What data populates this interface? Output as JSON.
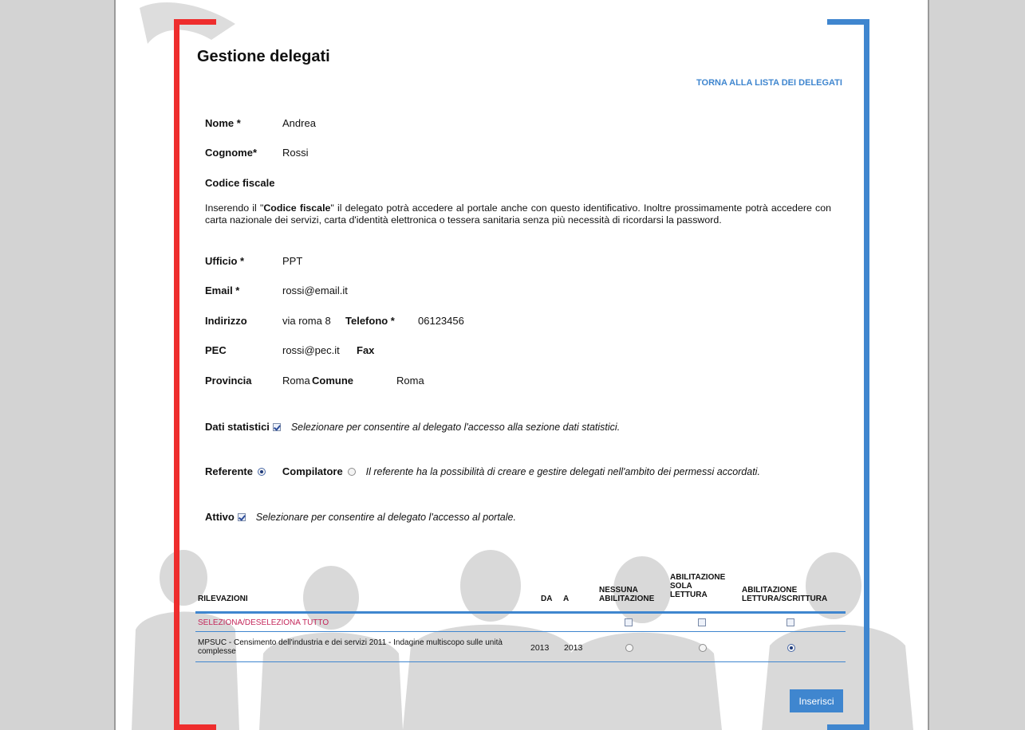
{
  "page": {
    "title": "Gestione delegati",
    "back_link": "TORNA ALLA LISTA DEI DELEGATI"
  },
  "form": {
    "nome": {
      "label": "Nome *",
      "value": "Andrea"
    },
    "cognome": {
      "label": "Cognome*",
      "value": "Rossi"
    },
    "codice_fiscale": {
      "label": "Codice fiscale"
    },
    "info": {
      "part1": "Inserendo il \"",
      "bold": "Codice fiscale",
      "part2": "\" il delegato potrà accedere al portale anche con questo identificativo. Inoltre prossimamente potrà accedere con carta nazionale dei servizi, carta d'identità elettronica o tessera sanitaria senza più necessità di ricordarsi la password."
    },
    "ufficio": {
      "label": "Ufficio *",
      "value": "PPT"
    },
    "email": {
      "label": "Email *",
      "value": "rossi@email.it"
    },
    "indirizzo": {
      "label": "Indirizzo",
      "value": "via roma 8"
    },
    "telefono": {
      "label": "Telefono *",
      "value": "06123456"
    },
    "pec": {
      "label": "PEC",
      "value": "rossi@pec.it"
    },
    "fax": {
      "label": "Fax",
      "value": ""
    },
    "provincia": {
      "label": "Provincia",
      "value": "Roma"
    },
    "comune": {
      "label": "Comune",
      "value": "Roma"
    },
    "dati_statistici": {
      "label": "Dati statistici",
      "checked": true,
      "note": "Selezionare per consentire al delegato l'accesso alla sezione dati statistici."
    },
    "ruolo": {
      "referente_label": "Referente",
      "compilatore_label": "Compilatore",
      "selected": "Referente",
      "note": "Il referente ha la possibilità di creare e gestire delegati nell'ambito dei permessi accordati."
    },
    "attivo": {
      "label": "Attivo",
      "checked": true,
      "note": "Selezionare per consentire al delegato l'accesso al portale."
    }
  },
  "table": {
    "headers": {
      "rilevazioni": "RILEVAZIONI",
      "da": "DA",
      "a": "A",
      "nessuna_1": "NESSUNA",
      "nessuna_2": "ABILITAZIONE",
      "sola_1": "ABILITAZIONE",
      "sola_2": "SOLA",
      "sola_3": "LETTURA",
      "scrittura_1": "ABILITAZIONE",
      "scrittura_2": "LETTURA/SCRITTURA"
    },
    "select_all": "SELEZIONA/DESELEZIONA TUTTO",
    "rows": [
      {
        "name": "MPSUC - Censimento dell'industria e dei servizi 2011 - Indagine multiscopo sulle unità complesse",
        "da": "2013",
        "a": "2013",
        "selected": "LETTURA/SCRITTURA"
      }
    ]
  },
  "buttons": {
    "submit": "Inserisci"
  },
  "colors": {
    "left_bracket": "#ee2d2d",
    "right_bracket": "#3f86cf",
    "link": "#3f86cf",
    "select_all": "#c4275a"
  }
}
